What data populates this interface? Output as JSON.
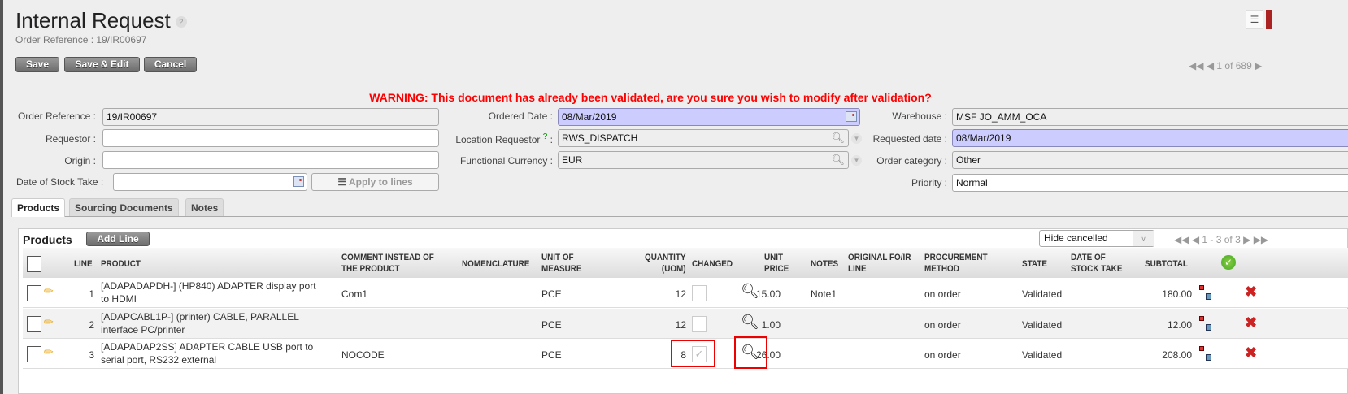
{
  "header": {
    "title": "Internal Request",
    "help": "?",
    "subtitle": "Order Reference : 19/IR00697"
  },
  "toolbar": {
    "save": "Save",
    "save_edit": "Save & Edit",
    "cancel": "Cancel",
    "pager": "1 of 689"
  },
  "warning": "WARNING: This document has already been validated, are you sure you wish to modify after validation?",
  "form": {
    "order_ref_label": "Order Reference :",
    "order_ref": "19/IR00697",
    "requestor_label": "Requestor :",
    "requestor": "",
    "origin_label": "Origin :",
    "origin": "",
    "stock_take_label": "Date of Stock Take :",
    "stock_take": "",
    "apply_label": "Apply to lines",
    "ordered_date_label": "Ordered Date :",
    "ordered_date": "08/Mar/2019",
    "loc_req_label": "Location Requestor",
    "loc_req_help": "?",
    "loc_req_colon": ":",
    "loc_req": "RWS_DISPATCH",
    "currency_label": "Functional Currency :",
    "currency": "EUR",
    "warehouse_label": "Warehouse :",
    "warehouse": "MSF JO_AMM_OCA",
    "requested_date_label": "Requested date :",
    "requested_date": "08/Mar/2019",
    "category_label": "Order category :",
    "category": "Other",
    "priority_label": "Priority :",
    "priority": "Normal"
  },
  "tabs": [
    "Products",
    "Sourcing Documents",
    "Notes"
  ],
  "products": {
    "title": "Products",
    "add_line": "Add Line",
    "filter": "Hide cancelled",
    "pager": "1 - 3 of 3",
    "columns": {
      "line": "LINE",
      "product": "PRODUCT",
      "comment1": "COMMENT INSTEAD OF",
      "comment2": "THE PRODUCT",
      "nomenclature": "NOMENCLATURE",
      "uom1": "UNIT OF",
      "uom2": "MEASURE",
      "qty1": "QUANTITY",
      "qty2": "(UOM)",
      "changed": "CHANGED",
      "price1": "UNIT",
      "price2": "PRICE",
      "notes": "NOTES",
      "orig1": "ORIGINAL FO/IR",
      "orig2": "LINE",
      "proc1": "PROCUREMENT",
      "proc2": "METHOD",
      "state": "STATE",
      "dst1": "DATE OF",
      "dst2": "STOCK TAKE",
      "subtotal": "SUBTOTAL"
    },
    "rows": [
      {
        "line": "1",
        "product1": "[ADAPADAPDH-] (HP840) ADAPTER display port",
        "product2": "to HDMI",
        "comment": "Com1",
        "uom": "PCE",
        "qty": "12",
        "changed": false,
        "price": "15.00",
        "notes": "Note1",
        "proc": "on order",
        "state": "Validated",
        "subtotal": "180.00"
      },
      {
        "line": "2",
        "product1": "[ADAPCABL1P-] (printer) CABLE, PARALLEL",
        "product2": "interface PC/printer",
        "comment": "",
        "uom": "PCE",
        "qty": "12",
        "changed": false,
        "price": "1.00",
        "notes": "",
        "proc": "on order",
        "state": "Validated",
        "subtotal": "12.00"
      },
      {
        "line": "3",
        "product1": "[ADAPADAP2SS] ADAPTER CABLE USB port to",
        "product2": "serial port, RS232 external",
        "comment": "NOCODE",
        "uom": "PCE",
        "qty": "8",
        "changed": true,
        "price": "26.00",
        "notes": "",
        "proc": "on order",
        "state": "Validated",
        "subtotal": "208.00"
      }
    ]
  }
}
